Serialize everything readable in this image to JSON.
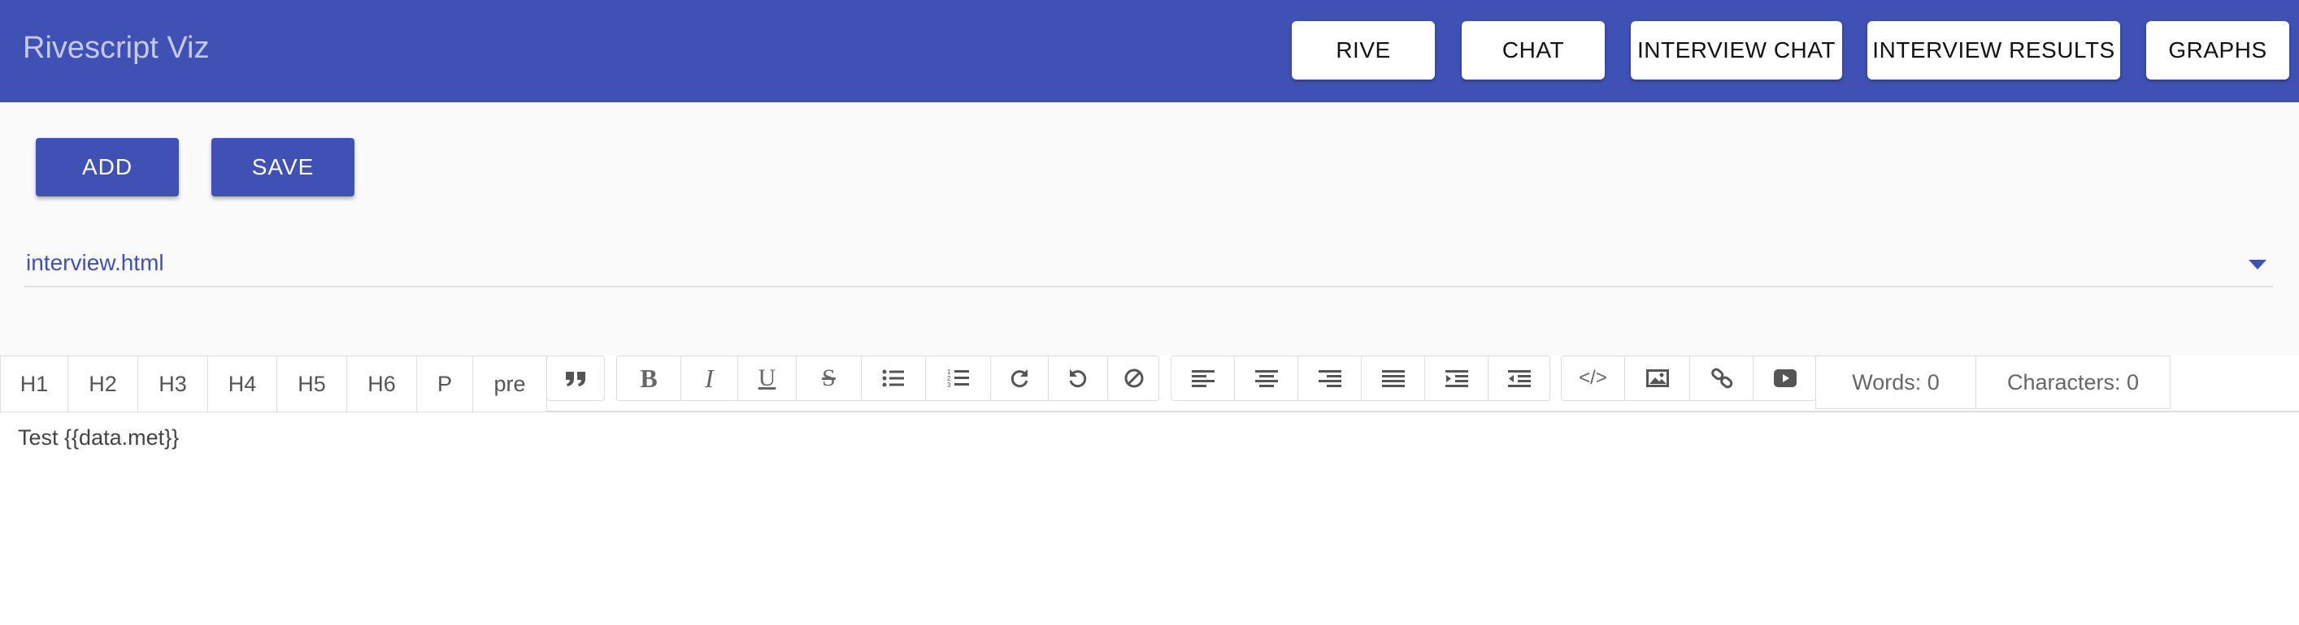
{
  "app": {
    "title": "Rivescript Viz"
  },
  "nav": {
    "rive": "RIVE",
    "chat": "CHAT",
    "interview_chat": "INTERVIEW CHAT",
    "interview_results": "INTERVIEW RESULTS",
    "graphs": "GRAPHS"
  },
  "actions": {
    "add": "ADD",
    "save": "SAVE"
  },
  "file_select": {
    "value": "interview.html"
  },
  "toolbar": {
    "headings": [
      "H1",
      "H2",
      "H3",
      "H4",
      "H5",
      "H6",
      "P",
      "pre"
    ],
    "words": "Words: 0",
    "characters": "Characters: 0"
  },
  "editor": {
    "content": "Test {{data.met}}"
  },
  "colors": {
    "primary": "#3f51b5",
    "background": "#fafafa"
  }
}
